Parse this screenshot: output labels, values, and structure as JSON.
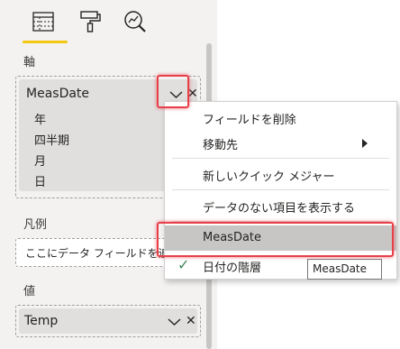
{
  "tabs": [
    {
      "name": "fields-tab",
      "icon": "table-grid-icon",
      "active": true
    },
    {
      "name": "format-tab",
      "icon": "paint-roller-icon"
    },
    {
      "name": "analytics-tab",
      "icon": "magnifier-chart-icon"
    }
  ],
  "sections": {
    "axis_label": "軸",
    "legend_label": "凡例",
    "values_label": "値"
  },
  "axis_well": {
    "field": "MeasDate",
    "hierarchy": [
      "年",
      "四半期",
      "月",
      "日"
    ]
  },
  "legend_well": {
    "placeholder": "ここにデータ フィールドを追加"
  },
  "values_well": {
    "field": "Temp"
  },
  "context_menu": {
    "items": [
      {
        "label": "フィールドを削除"
      },
      {
        "label": "移動先",
        "submenu": true
      },
      {
        "label": "新しいクイック メジャー"
      },
      {
        "label": "データのない項目を表示する"
      },
      {
        "label": "MeasDate",
        "highlighted": true
      },
      {
        "label": "日付の階層",
        "checked": true
      }
    ]
  },
  "tooltip": {
    "text": "MeasDate"
  },
  "colors": {
    "accent_underline": "#f2c811",
    "annotation": "#e8404a",
    "check": "#3f8a5a",
    "highlight": "#c8c6c4"
  }
}
